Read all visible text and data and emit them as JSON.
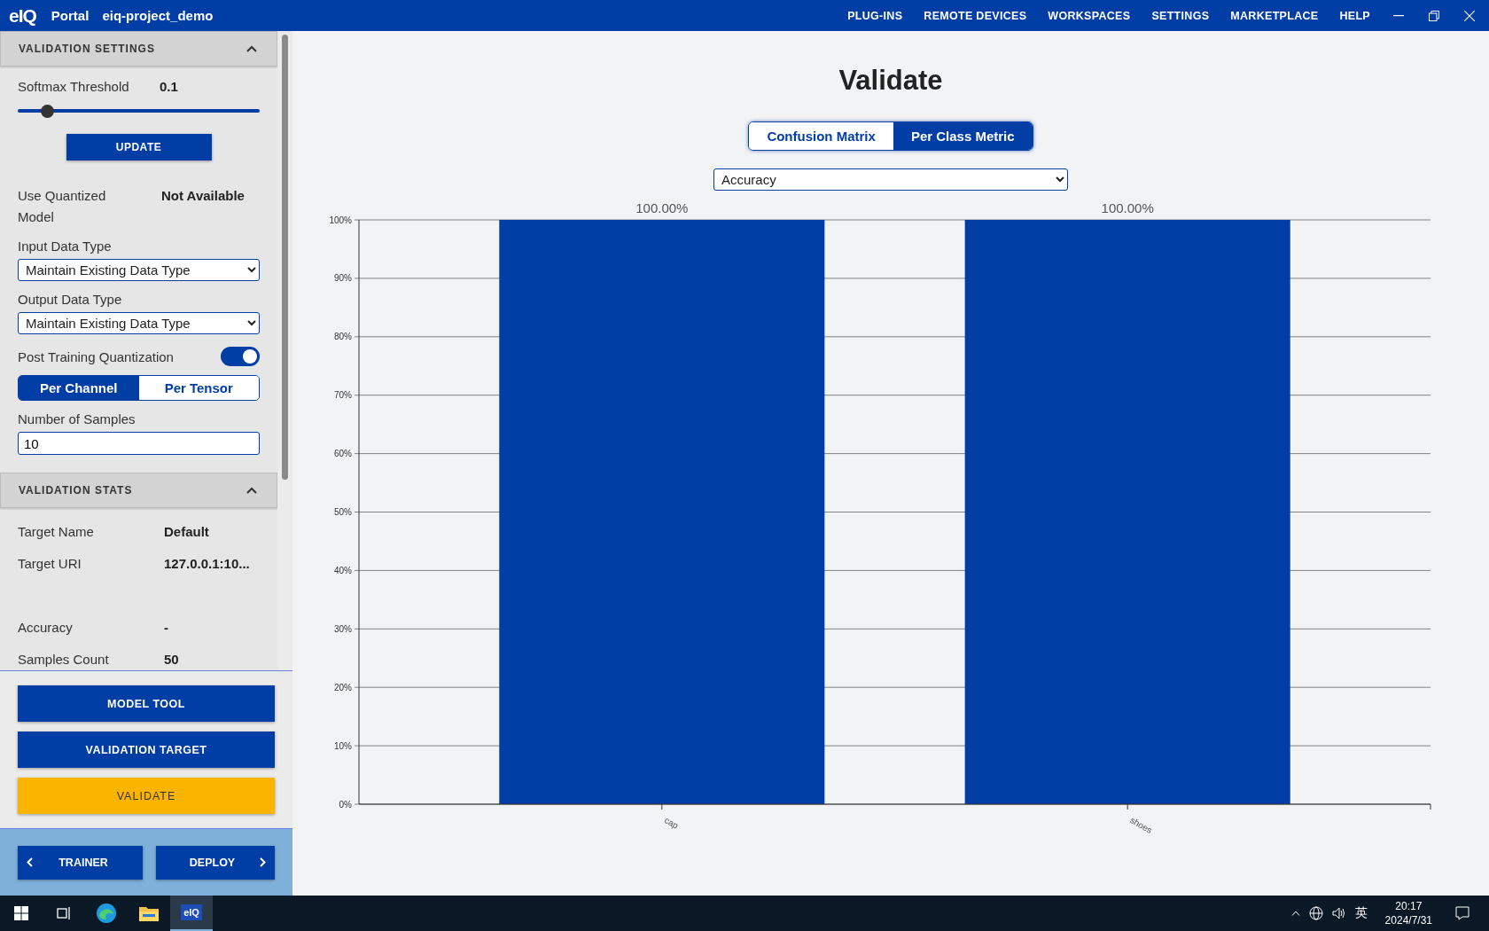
{
  "header": {
    "logo": "eIQ",
    "app": "Portal",
    "project": "eiq-project_demo",
    "nav": [
      "PLUG-INS",
      "REMOTE DEVICES",
      "WORKSPACES",
      "SETTINGS",
      "MARKETPLACE",
      "HELP"
    ]
  },
  "sidebar": {
    "settings": {
      "title": "VALIDATION SETTINGS",
      "expanded": true,
      "softmax": {
        "label": "Softmax Threshold",
        "value": "0.1",
        "level": 0.12
      },
      "update_button": "UPDATE",
      "quantized": {
        "label": "Use Quantized Model",
        "value": "Not Available"
      },
      "input_type": {
        "label": "Input Data Type",
        "value": "Maintain Existing Data Type"
      },
      "output_type": {
        "label": "Output Data Type",
        "value": "Maintain Existing Data Type"
      },
      "ptq": {
        "label": "Post Training Quantization",
        "on": true
      },
      "granularity": [
        {
          "label": "Per Channel",
          "selected": true
        },
        {
          "label": "Per Tensor",
          "selected": false
        }
      ],
      "samples": {
        "label": "Number of Samples",
        "value": "10"
      }
    },
    "stats": {
      "title": "VALIDATION STATS",
      "expanded": true,
      "target_rows": [
        {
          "label": "Target Name",
          "value": "Default"
        },
        {
          "label": "Target URI",
          "value": "127.0.0.1:10..."
        }
      ],
      "result_rows": [
        {
          "label": "Accuracy",
          "value": "-"
        },
        {
          "label": "Samples Count",
          "value": "50"
        }
      ]
    },
    "actions": [
      {
        "label": "MODEL TOOL",
        "kind": "primary"
      },
      {
        "label": "VALIDATION TARGET",
        "kind": "primary"
      },
      {
        "label": "VALIDATE",
        "kind": "accent"
      }
    ],
    "nav": [
      {
        "label": "TRAINER",
        "kind": "back"
      },
      {
        "label": "DEPLOY",
        "kind": "next"
      }
    ]
  },
  "main": {
    "title": "Validate",
    "views": [
      {
        "label": "Confusion Matrix",
        "selected": false
      },
      {
        "label": "Per Class Metric",
        "selected": true
      }
    ],
    "metric_select": {
      "value": "Accuracy"
    },
    "chart_data": {
      "type": "bar",
      "categories": [
        "cap",
        "shoes"
      ],
      "series": [
        {
          "color": "#003da5",
          "values": [
            100,
            100
          ]
        }
      ],
      "grid": true,
      "ylim": [
        0,
        100
      ],
      "yticks": [
        {
          "value": 0,
          "label": "0%"
        },
        {
          "value": 10,
          "label": "10%"
        },
        {
          "value": 20,
          "label": "20%"
        },
        {
          "value": 30,
          "label": "30%"
        },
        {
          "value": 40,
          "label": "40%"
        },
        {
          "value": 50,
          "label": "50%"
        },
        {
          "value": 60,
          "label": "60%"
        },
        {
          "value": 70,
          "label": "70%"
        },
        {
          "value": 80,
          "label": "80%"
        },
        {
          "value": 90,
          "label": "90%"
        },
        {
          "value": 100,
          "label": "100%"
        }
      ],
      "value_labels": [
        "100.00%",
        "100.00%"
      ]
    }
  },
  "taskbar": {
    "apps": [
      {
        "kind": "start",
        "selected": false
      },
      {
        "kind": "taskview",
        "selected": false
      },
      {
        "kind": "edge",
        "selected": false
      },
      {
        "kind": "explorer",
        "selected": false
      },
      {
        "kind": "eiq",
        "label": "eIQ",
        "selected": true
      }
    ],
    "ime": "英",
    "time": "20:17",
    "date": "2024/7/31"
  }
}
